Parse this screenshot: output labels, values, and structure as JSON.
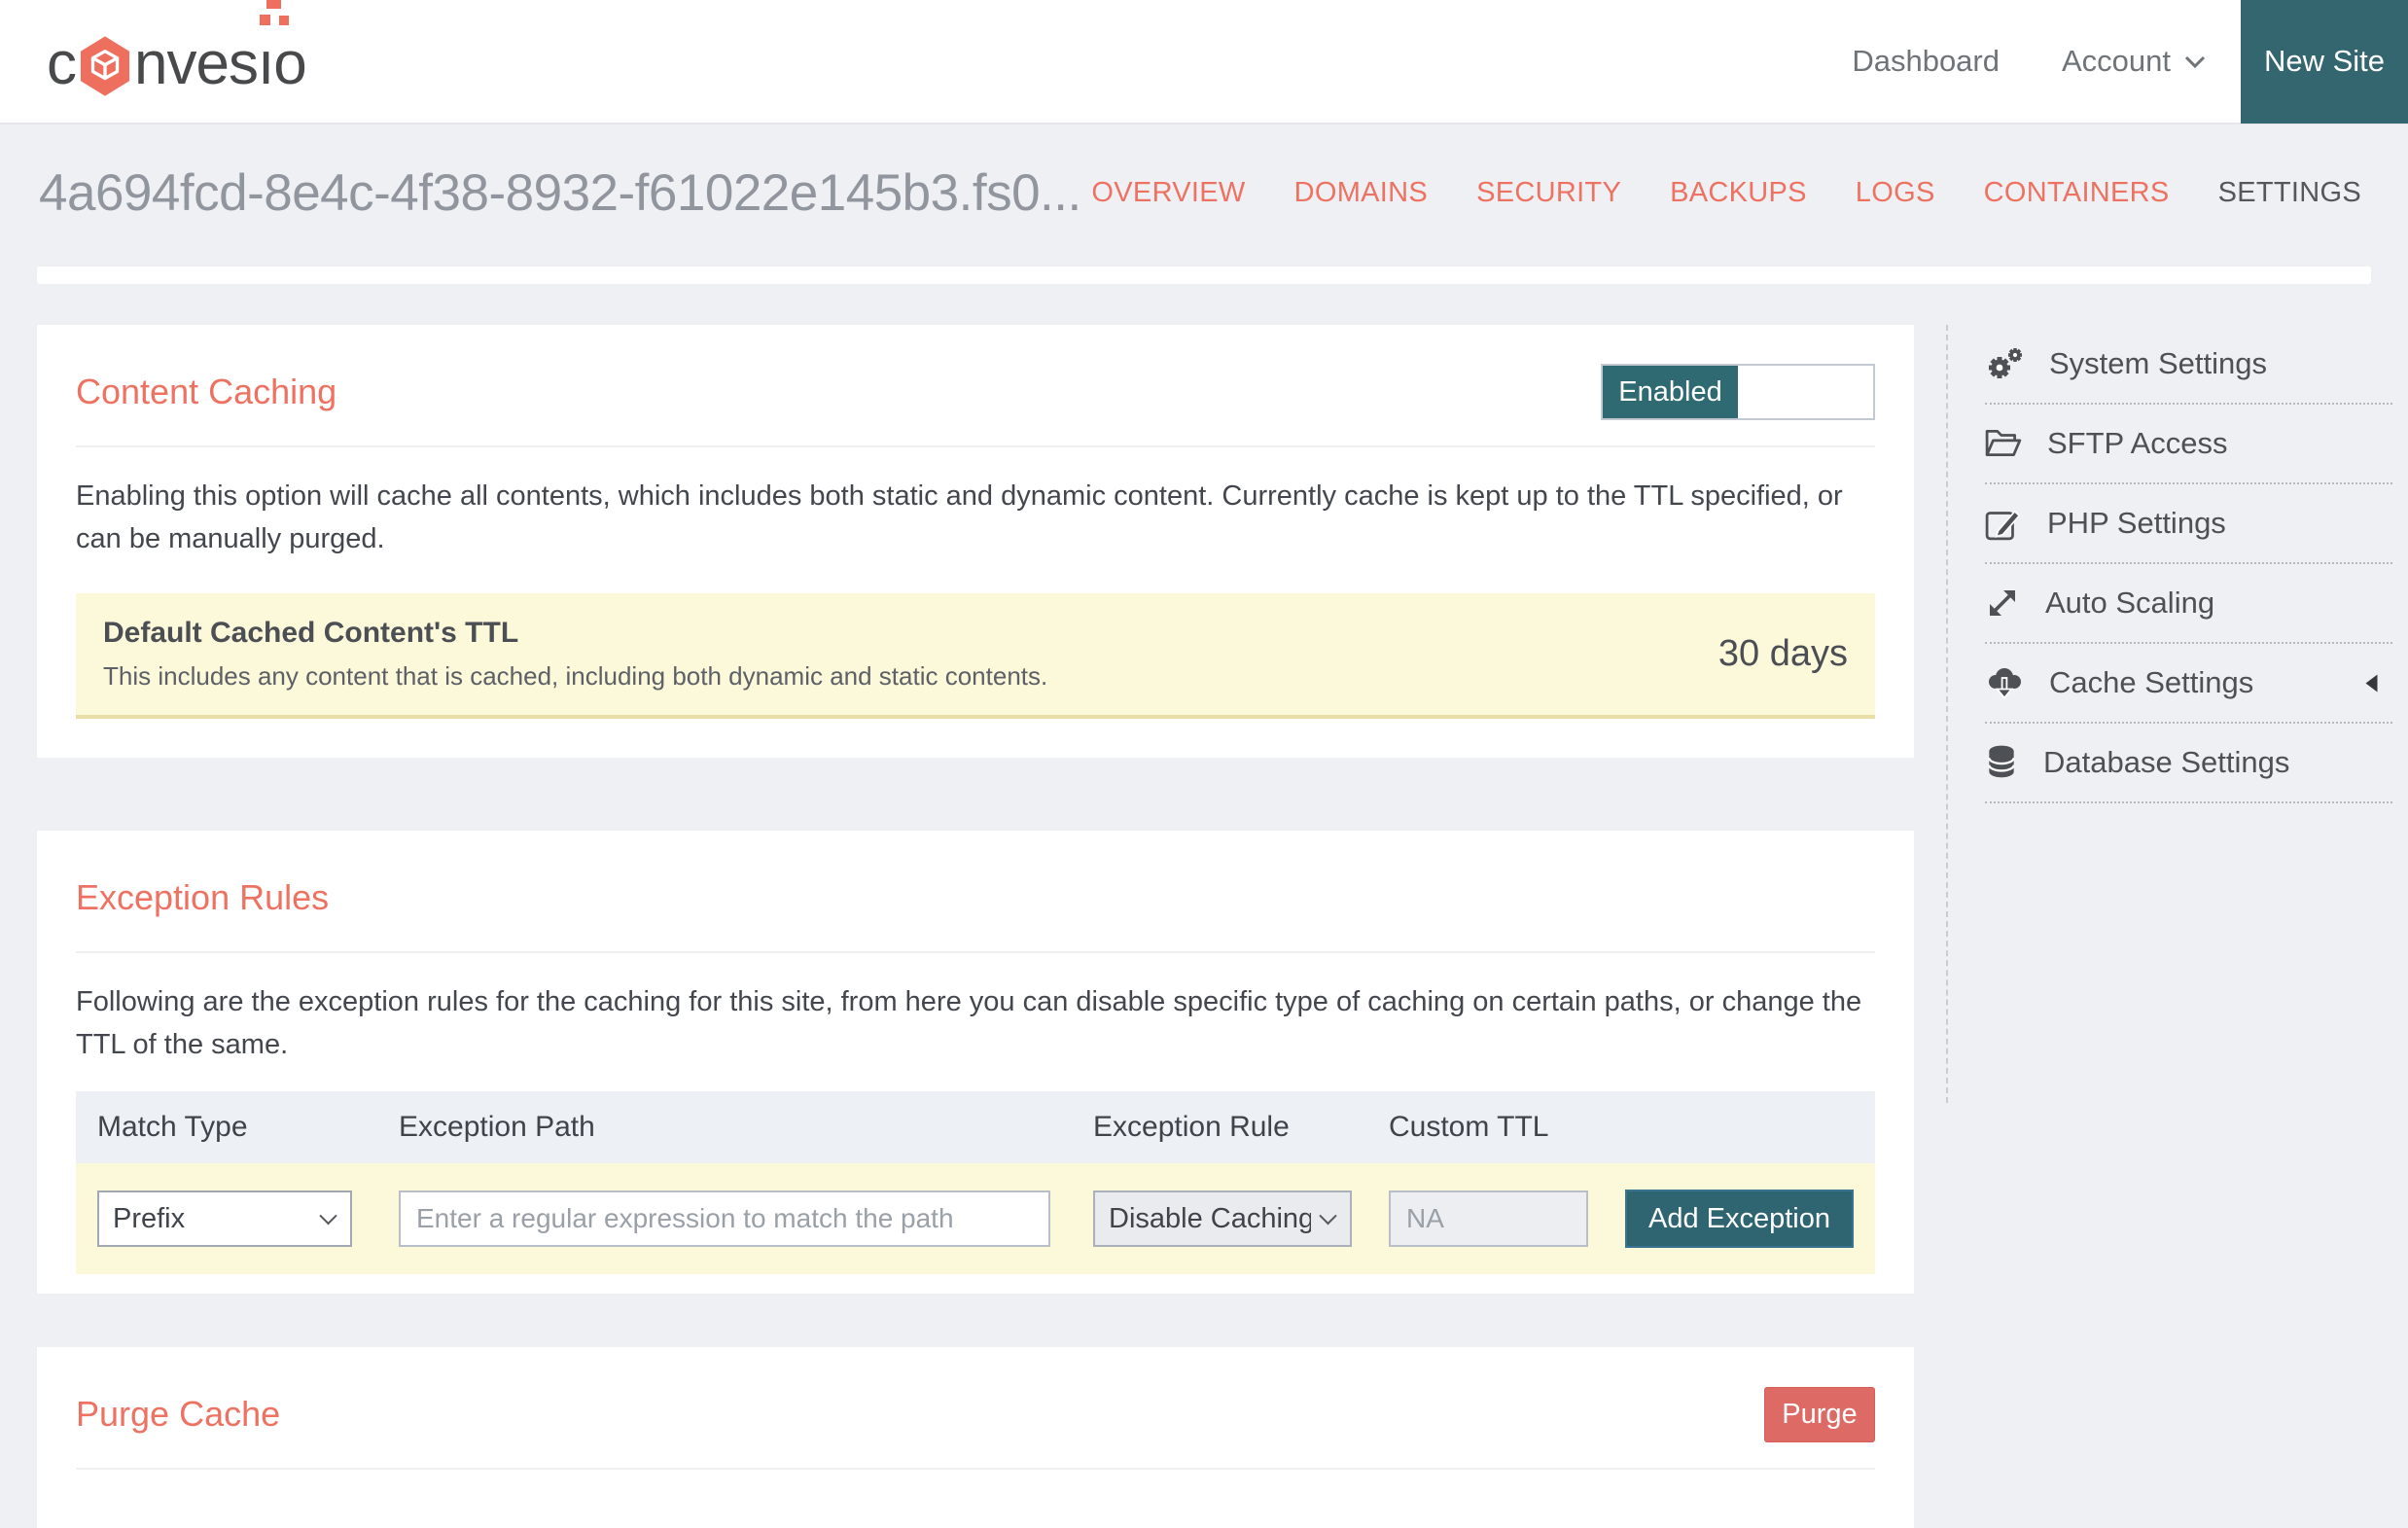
{
  "colors": {
    "accent_coral": "#ee7262",
    "teal": "#2f6a73",
    "danger_red": "#dd6a64",
    "highlight_yellow": "#fcf8da",
    "page_background": "#eef0f3",
    "table_header_bg": "#edf0f4"
  },
  "header": {
    "logo": {
      "text_pre": "c",
      "text_mid": "nves",
      "text_i": "ı",
      "text_end": "o",
      "icon": "convesio-hexcube-icon"
    },
    "nav": {
      "dashboard": "Dashboard",
      "account": "Account"
    },
    "new_site_label": "New Site"
  },
  "page": {
    "site_title": "4a694fcd-8e4c-4f38-8932-f61022e145b3.fs0..."
  },
  "tabs": [
    {
      "label": "OVERVIEW",
      "active": false
    },
    {
      "label": "DOMAINS",
      "active": false
    },
    {
      "label": "SECURITY",
      "active": false
    },
    {
      "label": "BACKUPS",
      "active": false
    },
    {
      "label": "LOGS",
      "active": false
    },
    {
      "label": "CONTAINERS",
      "active": false
    },
    {
      "label": "SETTINGS",
      "active": true
    }
  ],
  "content_caching": {
    "title": "Content Caching",
    "toggle_state": "Enabled",
    "description": "Enabling this option will cache all contents, which includes both static and dynamic content. Currently cache is kept up to the TTL specified, or can be manually purged.",
    "ttl_box": {
      "title": "Default Cached Content's TTL",
      "description": "This includes any content that is cached, including both dynamic and static contents.",
      "value": "30 days"
    }
  },
  "exception_rules": {
    "title": "Exception Rules",
    "description": "Following are the exception rules for the caching for this site, from here you can disable specific type of caching on certain paths, or change the TTL of the same.",
    "table": {
      "headers": [
        "Match Type",
        "Exception Path",
        "Exception Rule",
        "Custom TTL"
      ],
      "form": {
        "match_type_value": "Prefix",
        "path_value": "",
        "path_placeholder": "Enter a regular expression to match the path",
        "rule_value": "Disable Caching",
        "ttl_value": "",
        "ttl_placeholder": "NA",
        "add_button_label": "Add Exception"
      }
    }
  },
  "purge_cache": {
    "title": "Purge Cache",
    "button_label": "Purge"
  },
  "sidebar": {
    "items": [
      {
        "label": "System Settings",
        "icon": "gears-icon",
        "active": false
      },
      {
        "label": "SFTP Access",
        "icon": "folder-open-icon",
        "active": false
      },
      {
        "label": "PHP Settings",
        "icon": "edit-icon",
        "active": false
      },
      {
        "label": "Auto Scaling",
        "icon": "expand-arrows-icon",
        "active": false
      },
      {
        "label": "Cache Settings",
        "icon": "cloud-download-icon",
        "active": true
      },
      {
        "label": "Database Settings",
        "icon": "database-icon",
        "active": false
      }
    ]
  }
}
